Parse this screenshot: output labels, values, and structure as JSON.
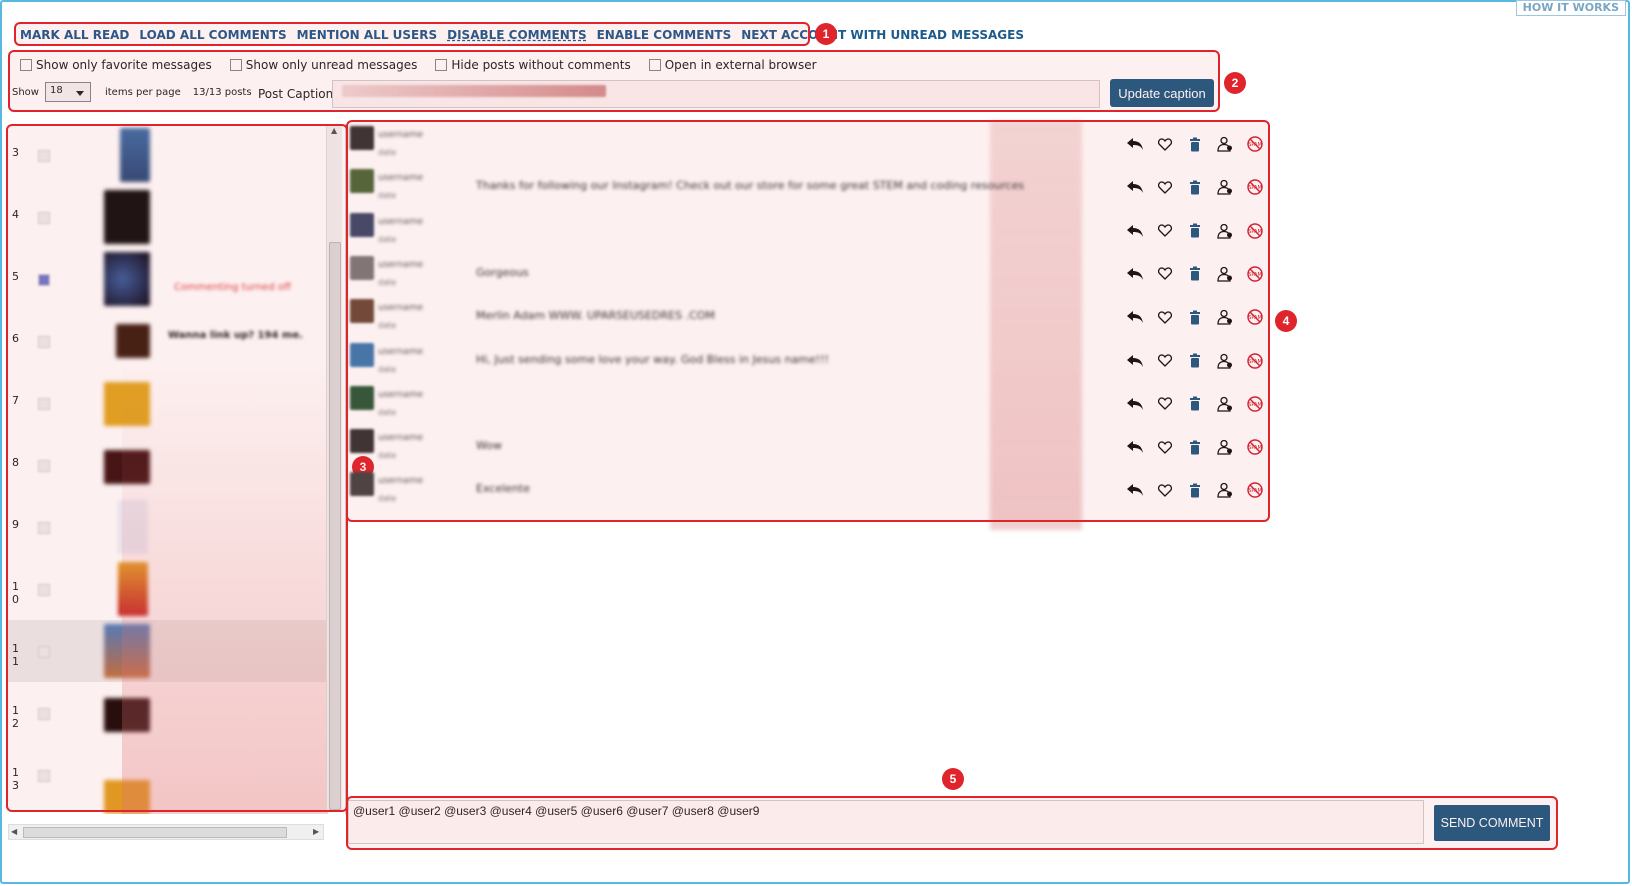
{
  "help_link": "HOW IT WORKS",
  "toolbar": {
    "items": [
      "MARK ALL READ",
      "LOAD ALL COMMENTS",
      "MENTION ALL USERS",
      "DISABLE COMMENTS",
      "ENABLE COMMENTS",
      "NEXT ACCOUNT WITH UNREAD MESSAGES"
    ],
    "active": "DISABLE COMMENTS"
  },
  "options": {
    "favorite": "Show only favorite messages",
    "unread": "Show only unread messages",
    "hide_no_comments": "Hide posts without comments",
    "external_browser": "Open in external browser"
  },
  "pager": {
    "show_label": "Show",
    "per_page_value": "18",
    "per_page_label": "items per page",
    "count": "13/13 posts"
  },
  "caption": {
    "label": "Post Caption:",
    "button": "Update caption"
  },
  "posts": [
    {
      "num": "3",
      "text": ""
    },
    {
      "num": "4",
      "text": ""
    },
    {
      "num": "5",
      "text": "Commenting turned off",
      "checked": true
    },
    {
      "num": "6",
      "text": "Wanna link up? 194 me."
    },
    {
      "num": "7",
      "text": ""
    },
    {
      "num": "8",
      "text": ""
    },
    {
      "num": "9",
      "text": ""
    },
    {
      "num": "10",
      "text": ""
    },
    {
      "num": "11",
      "text": ""
    },
    {
      "num": "12",
      "text": ""
    },
    {
      "num": "13",
      "text": ""
    }
  ],
  "comments": [
    {
      "text": ""
    },
    {
      "text": "Thanks for following our Instagram! Check out our store for some great STEM and coding resources"
    },
    {
      "text": ""
    },
    {
      "text": "Gorgeous"
    },
    {
      "text": "Merlin Adam WWW. UPARSEUSEDRES .COM"
    },
    {
      "text": "Hi, Just sending some love your way. God Bless in Jesus name!!!"
    },
    {
      "text": ""
    },
    {
      "text": "Wow"
    },
    {
      "text": "Excelente"
    }
  ],
  "composer": {
    "value": "@user1 @user2 @user3 @user4 @user5 @user6 @user7 @user8 @user9",
    "send_button": "SEND COMMENT"
  },
  "annotations": [
    "1",
    "2",
    "3",
    "4",
    "5"
  ],
  "colors": {
    "accent": "#1e5b84",
    "link": "#1c5b8c",
    "annotation": "#e0242c",
    "frame": "#57b8e0"
  }
}
